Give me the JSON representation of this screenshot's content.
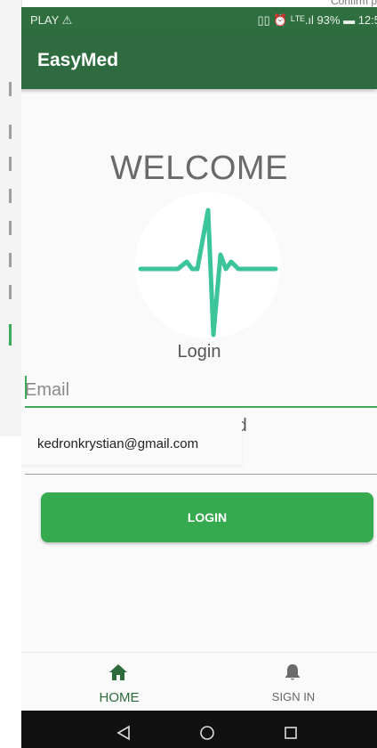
{
  "corner_text": "Confirm p",
  "status_bar": {
    "carrier": "PLAY ⚠",
    "indicators": "▯▯ ⏰ ᴸᵀᴱ.ıl 93% ▬ 12:5"
  },
  "app_bar": {
    "title": "EasyMed"
  },
  "main": {
    "welcome": "WELCOME",
    "login_label": "Login",
    "email_placeholder": "Email",
    "password_placeholder": "Password",
    "password_peek": "rd",
    "autofill_suggestion": "kedronkrystian@gmail.com",
    "login_button": "LOGIN"
  },
  "bottom_nav": {
    "home": "HOME",
    "sign_in": "SIGN IN"
  },
  "colors": {
    "app_bar": "#2e6b3e",
    "accent": "#35aa4e",
    "heartbeat": "#3cc59a"
  },
  "icons": {
    "logo": "heartbeat-icon",
    "home": "home-icon",
    "sign_in": "bell-icon",
    "back": "back-triangle-icon",
    "home_circle": "home-circle-icon",
    "recents": "recents-square-icon"
  }
}
